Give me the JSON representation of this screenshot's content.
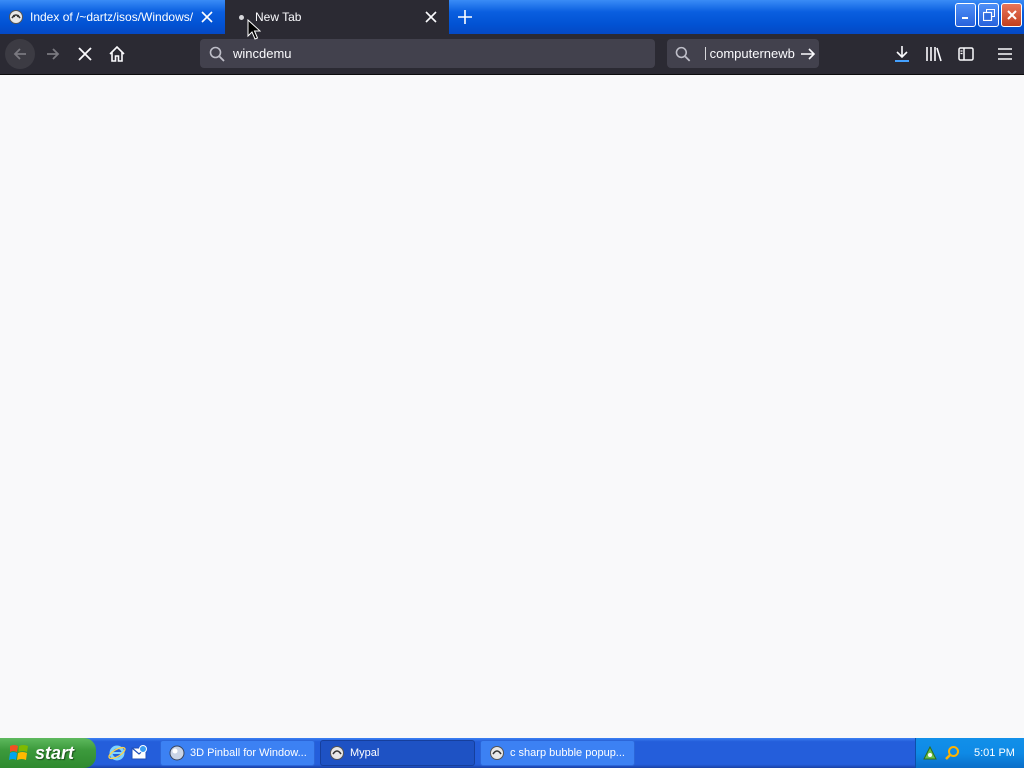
{
  "tabs": [
    {
      "label": "Index of /~dartz/isos/Windows/",
      "favicon": "mypal-icon",
      "active": false
    },
    {
      "label": "New Tab",
      "favicon": "loading-dot",
      "active": true
    }
  ],
  "navbar": {
    "url": "wincdemu",
    "search_value": "computernewb"
  },
  "taskbar": {
    "start_label": "start",
    "quick_launch": [
      "internet-explorer-icon",
      "outlook-express-icon"
    ],
    "tasks": [
      {
        "label": "3D Pinball for Window...",
        "icon": "pinball-icon",
        "active": false
      },
      {
        "label": "Mypal",
        "icon": "mypal-icon",
        "active": true
      },
      {
        "label": "c sharp bubble popup...",
        "icon": "mypal-icon",
        "active": false
      }
    ],
    "tray_icons": [
      "network-icon",
      "search-tray-icon"
    ],
    "clock": "5:01 PM"
  },
  "colors": {
    "titlebar_blue": "#0253d4",
    "toolbar_dark": "#2b2a33",
    "field_dark": "#42414d",
    "content_bg": "#f9f9fa",
    "start_green": "#3c9a3c",
    "taskbar_blue": "#245edb"
  }
}
